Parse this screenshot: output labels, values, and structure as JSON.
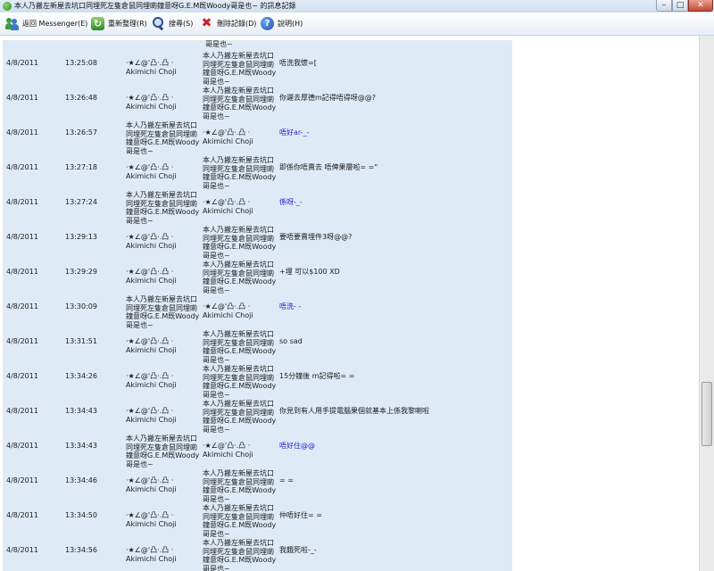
{
  "window": {
    "title": "本人乃搬左新屋去坑口同埋死左隻倉鼠同埋啲鐘意呀G.E.M既Woody哥是也~ 的訊息記錄",
    "minimize_glyph": "–",
    "maximize_glyph": "□",
    "close_glyph": "✕"
  },
  "toolbar": {
    "back": "返回 Messenger(E)",
    "refresh": "重新整理(R)",
    "search": "搜尋(S)",
    "delete": "刪除記錄(D)",
    "help": "說明(H)",
    "refresh_glyph": "↻",
    "delete_glyph": "✖",
    "help_glyph": "?"
  },
  "log": {
    "top_fragment": "哥是也~",
    "rows": [
      {
        "date": "4/8/2011",
        "time": "13:25:08",
        "from": "本人乃搬左新屋去坑口同埋死左隻倉鼠同埋啲鐘意呀G.E.M既Woody哥是也~",
        "to": "·★∠@'凸·.凸 ·\nAkimichi Choji",
        "msg": "唔洗我懷=[",
        "alt": false,
        "swap": true
      },
      {
        "date": "4/8/2011",
        "time": "13:26:48",
        "from": "·★∠@'凸·.凸 ·\nAkimichi Choji",
        "to": "本人乃搬左新屋去坑口同埋死左隻倉鼠同埋啲鐘意呀G.E.M既Woody哥是也~",
        "msg": "你遲去厚德m記得唔得呀@@?",
        "alt": false,
        "swap": false
      },
      {
        "date": "4/8/2011",
        "time": "13:26:57",
        "from": "本人乃搬左新屋去坑口同埋死左隻倉鼠同埋啲鐘意呀G.E.M既Woody哥是也~",
        "to": "·★∠@'凸·.凸 ·\nAkimichi Choji",
        "msg": "唔好ar-_-",
        "alt": true,
        "swap": false
      },
      {
        "date": "4/8/2011",
        "time": "13:27:18",
        "from": "·★∠@'凸·.凸 ·\nAkimichi Choji",
        "to": "本人乃搬左新屋去坑口同埋死左隻倉鼠同埋啲鐘意呀G.E.M既Woody哥是也~",
        "msg": "即係你唔賣去 唔俾果層啦= =\"",
        "alt": false,
        "swap": false
      },
      {
        "date": "4/8/2011",
        "time": "13:27:24",
        "from": "本人乃搬左新屋去坑口同埋死左隻倉鼠同埋啲鐘意呀G.E.M既Woody哥是也~",
        "to": "·★∠@'凸·.凸 ·\nAkimichi Choji",
        "msg": "係呀-_-",
        "alt": true,
        "swap": false
      },
      {
        "date": "4/8/2011",
        "time": "13:29:13",
        "from": "·★∠@'凸·.凸 ·\nAkimichi Choji",
        "to": "本人乃搬左新屋去坑口同埋死左隻倉鼠同埋啲鐘意呀G.E.M既Woody哥是也~",
        "msg": "要唔要賣埋件3呀@@?",
        "alt": false,
        "swap": false
      },
      {
        "date": "4/8/2011",
        "time": "13:29:29",
        "from": "·★∠@'凸·.凸 ·\nAkimichi Choji",
        "to": "本人乃搬左新屋去坑口同埋死左隻倉鼠同埋啲鐘意呀G.E.M既Woody哥是也~",
        "msg": "+埋 可以$100 XD",
        "alt": false,
        "swap": false
      },
      {
        "date": "4/8/2011",
        "time": "13:30:09",
        "from": "本人乃搬左新屋去坑口同埋死左隻倉鼠同埋啲鐘意呀G.E.M既Woody哥是也~",
        "to": "·★∠@'凸·.凸 ·\nAkimichi Choji",
        "msg": "唔洗- -",
        "alt": true,
        "swap": false
      },
      {
        "date": "4/8/2011",
        "time": "13:31:51",
        "from": "·★∠@'凸·.凸 ·\nAkimichi Choji",
        "to": "本人乃搬左新屋去坑口同埋死左隻倉鼠同埋啲鐘意呀G.E.M既Woody哥是也~",
        "msg": "so sad",
        "alt": false,
        "swap": false
      },
      {
        "date": "4/8/2011",
        "time": "13:34:26",
        "from": "·★∠@'凸·.凸 ·\nAkimichi Choji",
        "to": "本人乃搬左新屋去坑口同埋死左隻倉鼠同埋啲鐘意呀G.E.M既Woody哥是也~",
        "msg": "15分鐘後 m記得啦= =",
        "alt": false,
        "swap": false
      },
      {
        "date": "4/8/2011",
        "time": "13:34:43",
        "from": "·★∠@'凸·.凸 ·\nAkimichi Choji",
        "to": "本人乃搬左新屋去坑口同埋死左隻倉鼠同埋啲鐘意呀G.E.M既Woody哥是也~",
        "msg": "你見到有人用手提電腦果個就基本上係我黎喇啦",
        "alt": false,
        "swap": false
      },
      {
        "date": "4/8/2011",
        "time": "13:34:43",
        "from": "本人乃搬左新屋去坑口同埋死左隻倉鼠同埋啲鐘意呀G.E.M既Woody哥是也~",
        "to": "·★∠@'凸·.凸 ·\nAkimichi Choji",
        "msg": "唔好住@@",
        "alt": true,
        "swap": false
      },
      {
        "date": "4/8/2011",
        "time": "13:34:46",
        "from": "·★∠@'凸·.凸 ·\nAkimichi Choji",
        "to": "本人乃搬左新屋去坑口同埋死左隻倉鼠同埋啲鐘意呀G.E.M既Woody哥是也~",
        "msg": "= =",
        "alt": false,
        "swap": false
      },
      {
        "date": "4/8/2011",
        "time": "13:34:50",
        "from": "·★∠@'凸·.凸 ·\nAkimichi Choji",
        "to": "本人乃搬左新屋去坑口同埋死左隻倉鼠同埋啲鐘意呀G.E.M既Woody哥是也~",
        "msg": "仲唔好住= =",
        "alt": false,
        "swap": false
      },
      {
        "date": "4/8/2011",
        "time": "13:34:56",
        "from": "·★∠@'凸·.凸 ·\nAkimichi Choji",
        "to": "本人乃搬左新屋去坑口同埋死左隻倉鼠同埋啲鐘意呀G.E.M既Woody哥是也~",
        "msg": "我餓死啦-_-",
        "alt": false,
        "swap": false
      }
    ]
  },
  "colors": {
    "panel_bg": "#deebf7",
    "alt_message": "#1f1fcc"
  }
}
